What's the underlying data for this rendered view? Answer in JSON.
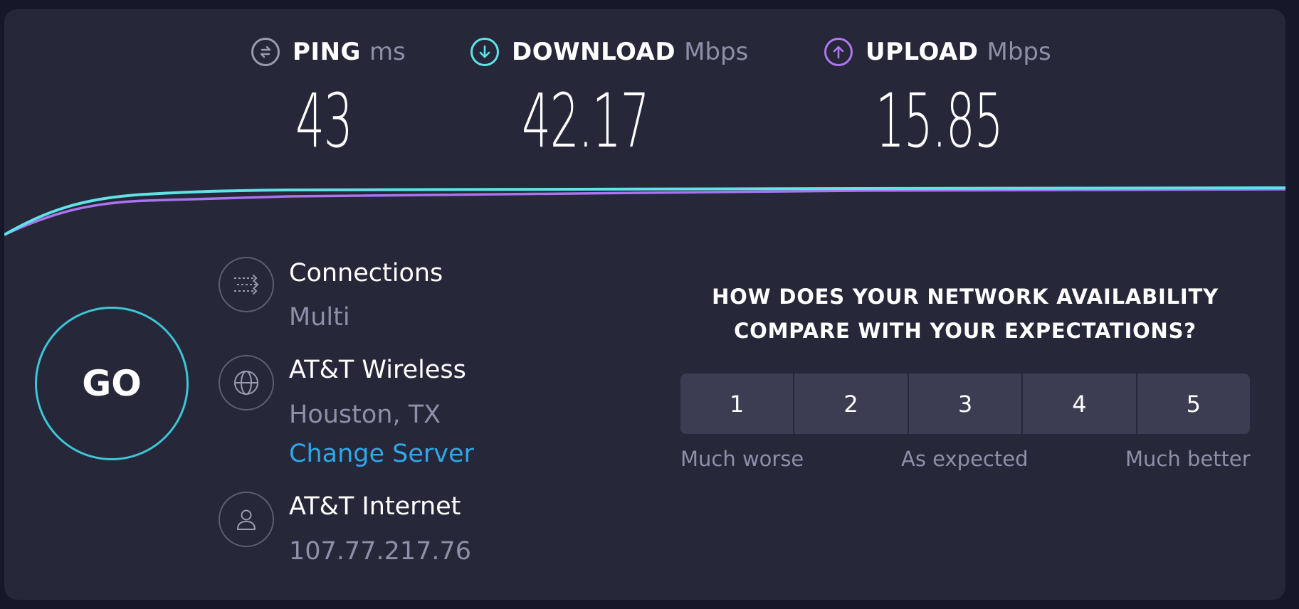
{
  "metrics": {
    "ping": {
      "label": "PING",
      "unit": "ms",
      "value": "43",
      "icon": "ping-icon",
      "color": "#9a9bb0"
    },
    "download": {
      "label": "DOWNLOAD",
      "unit": "Mbps",
      "value": "42.17",
      "icon": "download-arrow-icon",
      "color": "#5fe3e6"
    },
    "upload": {
      "label": "UPLOAD",
      "unit": "Mbps",
      "value": "15.85",
      "icon": "upload-arrow-icon",
      "color": "#b077f0"
    }
  },
  "graph": {
    "download_color": "#5fe3e6",
    "upload_color": "#a874f0"
  },
  "go": {
    "label": "GO",
    "ring_color": "#3cc6d8"
  },
  "connections": {
    "title": "Connections",
    "value": "Multi",
    "icon": "connections-icon"
  },
  "server": {
    "name": "AT&T Wireless",
    "location": "Houston, TX",
    "change_label": "Change Server",
    "icon": "globe-icon"
  },
  "provider": {
    "name": "AT&T Internet",
    "ip": "107.77.217.76",
    "icon": "user-icon"
  },
  "survey": {
    "question_line1": "HOW DOES YOUR NETWORK AVAILABILITY",
    "question_line2": "COMPARE WITH YOUR EXPECTATIONS?",
    "options": [
      "1",
      "2",
      "3",
      "4",
      "5"
    ],
    "label_low": "Much worse",
    "label_mid": "As expected",
    "label_high": "Much better"
  }
}
